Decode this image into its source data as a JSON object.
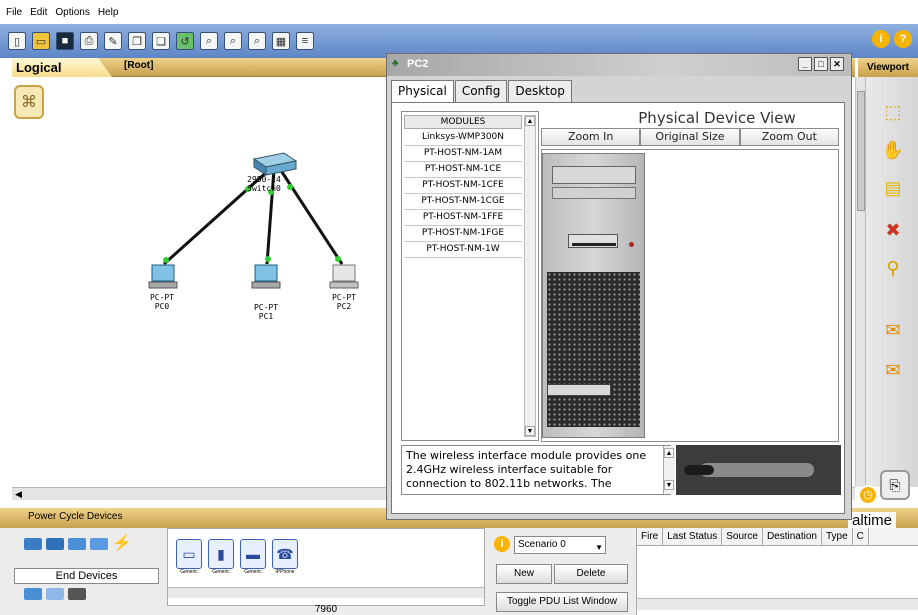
{
  "menu": [
    "File",
    "Edit",
    "Options",
    "Help"
  ],
  "logical": {
    "tab_label": "Logical",
    "root": "[Root]",
    "viewport": "Viewport"
  },
  "topology": {
    "switch": {
      "model": "2950-24",
      "name": "Switch0"
    },
    "pcs": [
      {
        "model": "PC-PT",
        "name": "PC0"
      },
      {
        "model": "PC-PT",
        "name": "PC1"
      },
      {
        "model": "PC-PT",
        "name": "PC2"
      }
    ]
  },
  "window": {
    "title": "PC2",
    "tabs": [
      "Physical",
      "Config",
      "Desktop"
    ],
    "active_tab": "Physical",
    "modules_header": "MODULES",
    "modules": [
      "Linksys-WMP300N",
      "PT-HOST-NM-1AM",
      "PT-HOST-NM-1CE",
      "PT-HOST-NM-1CFE",
      "PT-HOST-NM-1CGE",
      "PT-HOST-NM-1FFE",
      "PT-HOST-NM-1FGE",
      "PT-HOST-NM-1W"
    ],
    "device_view_title": "Physical Device View",
    "zoom_in": "Zoom In",
    "original_size": "Original Size",
    "zoom_out": "Zoom Out",
    "description": "The wireless interface module provides one 2.4GHz wireless interface suitable for connection to 802.11b networks. The"
  },
  "bottom": {
    "power_cycle": "Power Cycle Devices",
    "realtime": "altime",
    "end_devices": "End Devices",
    "device_items": [
      "Generic",
      "Generic",
      "Generic",
      "IPPhone"
    ],
    "device_count": "7960",
    "scenario": "Scenario 0",
    "new_label": "New",
    "delete_label": "Delete",
    "toggle_pdu": "Toggle PDU List Window",
    "pdu_columns": [
      "Fire",
      "Last Status",
      "Source",
      "Destination",
      "Type",
      "C"
    ]
  },
  "colors": {
    "toolbar": "#6f94cf",
    "tab_bar": "#d8b56a",
    "link": "#111111",
    "port_light": "#2fd12f"
  }
}
